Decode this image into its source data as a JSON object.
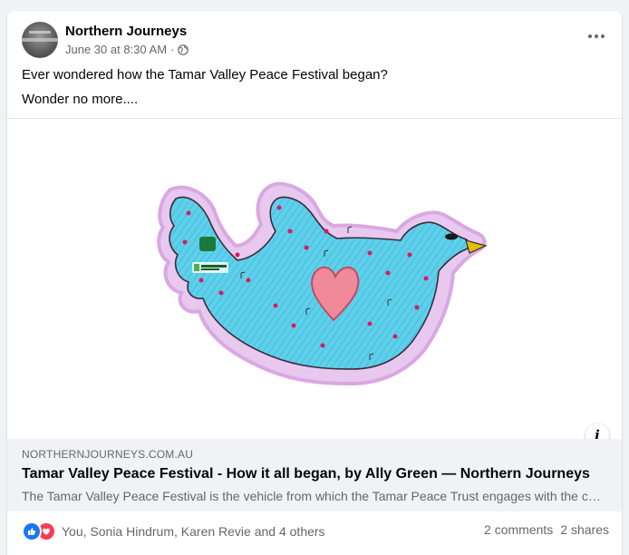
{
  "post": {
    "page_name": "Northern Journeys",
    "timestamp": "June 30 at 8:30 AM",
    "separator": "·",
    "privacy_icon": "globe-icon",
    "text_line1": "Ever wondered how the Tamar Valley Peace Festival began?",
    "text_line2": "Wonder no more...."
  },
  "image": {
    "description_icon": "info-icon",
    "info_label": "i"
  },
  "link_preview": {
    "domain": "NORTHERNJOURNEYS.COM.AU",
    "title": "Tamar Valley Peace Festival - How it all began, by Ally Green — Northern Journeys",
    "description": "The Tamar Valley Peace Festival is the vehicle from which the Tamar Peace Trust engages with the community"
  },
  "engagement": {
    "reaction_icons": [
      "like-icon",
      "love-icon"
    ],
    "reaction_names": "You, Sonia Hindrum, Karen Revie and 4 others",
    "comments": "2 comments",
    "shares": "2 shares"
  },
  "colors": {
    "like_blue": "#1877f2",
    "love_red": "#f33e58",
    "secondary_text": "#65676b",
    "link_box_bg": "#f0f2f5"
  }
}
